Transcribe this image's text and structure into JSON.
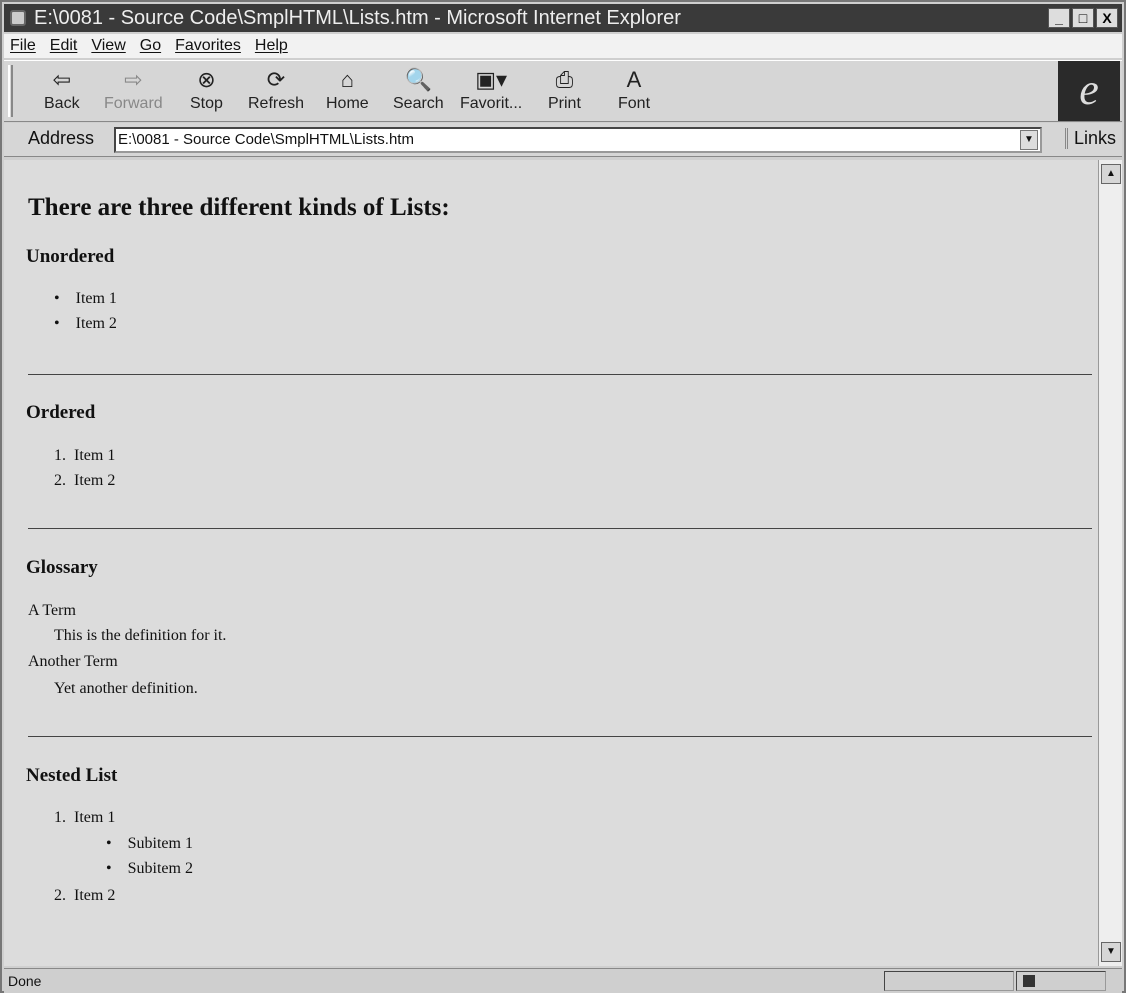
{
  "window": {
    "title": "E:\\0081 - Source Code\\SmplHTML\\Lists.htm - Microsoft Internet Explorer",
    "controls": [
      "_",
      "□",
      "X"
    ]
  },
  "menu": [
    "File",
    "Edit",
    "View",
    "Go",
    "Favorites",
    "Help"
  ],
  "toolbar": [
    {
      "label": "Back",
      "icon": "back-arrow-icon",
      "glyph": "⇦"
    },
    {
      "label": "Forward",
      "icon": "forward-arrow-icon",
      "glyph": "⇨"
    },
    {
      "label": "Stop",
      "icon": "stop-icon",
      "glyph": "⊗"
    },
    {
      "label": "Refresh",
      "icon": "refresh-icon",
      "glyph": "⟳"
    },
    {
      "label": "Home",
      "icon": "home-icon",
      "glyph": "⌂"
    },
    {
      "label": "Search",
      "icon": "search-icon",
      "glyph": "🔍"
    },
    {
      "label": "Favorit...",
      "icon": "favorites-folder-icon",
      "glyph": "▣▾"
    },
    {
      "label": "Print",
      "icon": "printer-icon",
      "glyph": "⎙"
    },
    {
      "label": "Font",
      "icon": "font-icon",
      "glyph": "A"
    }
  ],
  "address": {
    "label": "Address",
    "value": "E:\\0081 - Source Code\\SmplHTML\\Lists.htm",
    "links": "Links"
  },
  "page": {
    "heading": "There are three different kinds of Lists:",
    "unordered": {
      "title": "Unordered",
      "items": [
        "Item 1",
        "Item 2"
      ]
    },
    "ordered": {
      "title": "Ordered",
      "items": [
        "Item 1",
        "Item 2"
      ]
    },
    "glossary": {
      "title": "Glossary",
      "terms": [
        {
          "term": "A Term",
          "def": "This is the definition for it."
        },
        {
          "term": "Another Term",
          "def": "Yet another definition."
        }
      ]
    },
    "nested": {
      "title": "Nested List",
      "items": [
        "Item 1",
        "Item 2"
      ],
      "subitems": [
        "Subitem 1",
        "Subitem 2"
      ]
    }
  },
  "status": {
    "text": "Done"
  }
}
